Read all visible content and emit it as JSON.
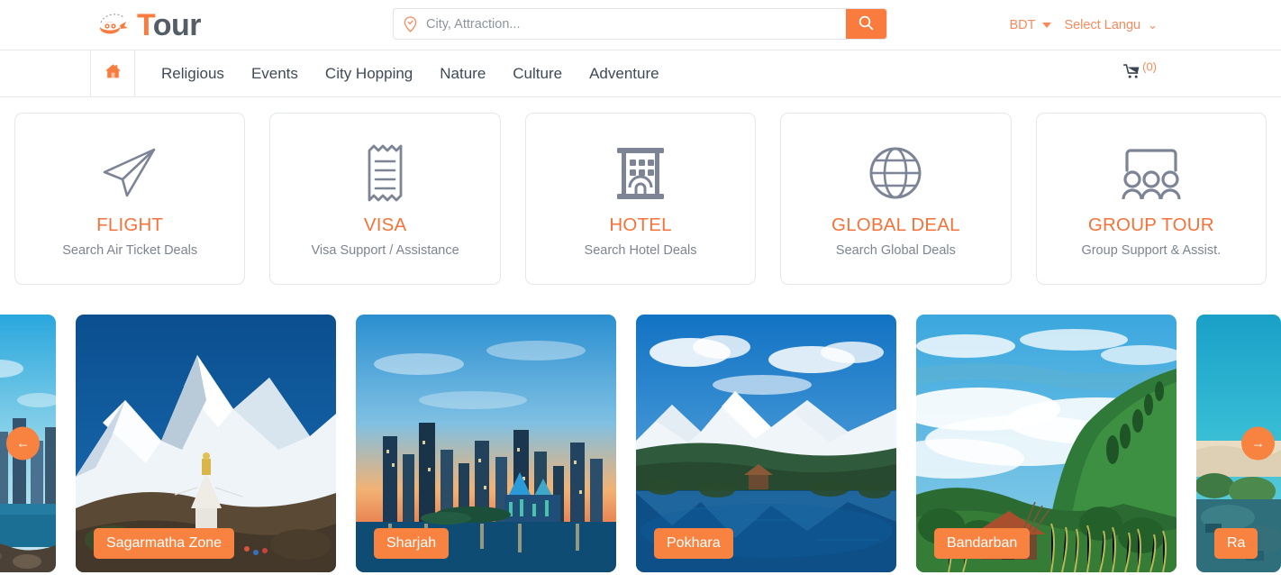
{
  "brand": {
    "name_accent": "T",
    "name_rest": "our",
    "accent_color": "#f97b3d"
  },
  "search": {
    "placeholder": "City, Attraction...",
    "value": ""
  },
  "header": {
    "currency": "BDT",
    "language": "Select Langu"
  },
  "nav": {
    "items": [
      {
        "label": "Religious"
      },
      {
        "label": "Events"
      },
      {
        "label": "City Hopping"
      },
      {
        "label": "Nature"
      },
      {
        "label": "Culture"
      },
      {
        "label": "Adventure"
      }
    ],
    "cart_count": "(0)"
  },
  "services": [
    {
      "icon": "paper-plane-icon",
      "title": "FLIGHT",
      "subtitle": "Search Air Ticket Deals"
    },
    {
      "icon": "receipt-icon",
      "title": "VISA",
      "subtitle": "Visa Support / Assistance"
    },
    {
      "icon": "hotel-building-icon",
      "title": "HOTEL",
      "subtitle": "Search Hotel Deals"
    },
    {
      "icon": "globe-icon",
      "title": "GLOBAL DEAL",
      "subtitle": "Search Global Deals"
    },
    {
      "icon": "group-people-icon",
      "title": "GROUP TOUR",
      "subtitle": "Group Support & Assist."
    }
  ],
  "carousel": {
    "prev_label": "←",
    "next_label": "→",
    "cards": [
      {
        "label": "",
        "partial": true
      },
      {
        "label": "Sagarmatha Zone",
        "partial": false
      },
      {
        "label": "Sharjah",
        "partial": false
      },
      {
        "label": "Pokhara",
        "partial": false
      },
      {
        "label": "Bandarban",
        "partial": false
      },
      {
        "label": "Ra",
        "partial": true
      }
    ]
  }
}
